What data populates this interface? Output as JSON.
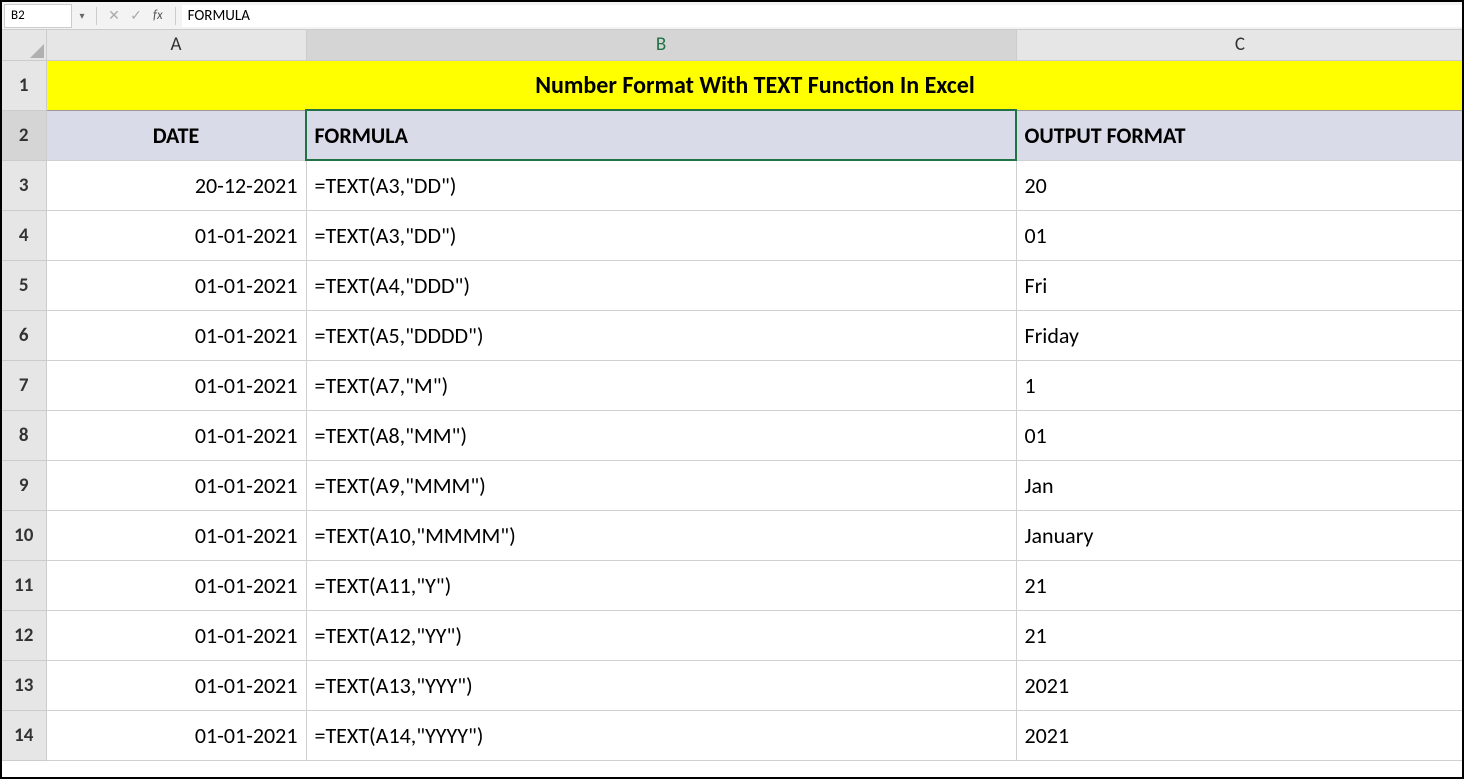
{
  "formula_bar": {
    "name_box": "B2",
    "fx_label": "fx",
    "formula_value": "FORMULA"
  },
  "columns": [
    "A",
    "B",
    "C"
  ],
  "row_headers": [
    "1",
    "2",
    "3",
    "4",
    "5",
    "6",
    "7",
    "8",
    "9",
    "10",
    "11",
    "12",
    "13",
    "14"
  ],
  "title": "Number Format With TEXT Function In Excel",
  "headers": {
    "A": "DATE",
    "B": "FORMULA",
    "C": "OUTPUT FORMAT"
  },
  "rows": [
    {
      "A": "20-12-2021",
      "B": "=TEXT(A3,\"DD\")",
      "C": "20"
    },
    {
      "A": "01-01-2021",
      "B": "=TEXT(A3,\"DD\")",
      "C": "01"
    },
    {
      "A": "01-01-2021",
      "B": "=TEXT(A4,\"DDD\")",
      "C": "Fri"
    },
    {
      "A": "01-01-2021",
      "B": "=TEXT(A5,\"DDDD\")",
      "C": "Friday"
    },
    {
      "A": "01-01-2021",
      "B": "=TEXT(A7,\"M\")",
      "C": "1"
    },
    {
      "A": "01-01-2021",
      "B": "=TEXT(A8,\"MM\")",
      "C": "01"
    },
    {
      "A": "01-01-2021",
      "B": "=TEXT(A9,\"MMM\")",
      "C": "Jan"
    },
    {
      "A": "01-01-2021",
      "B": "=TEXT(A10,\"MMMM\")",
      "C": "January"
    },
    {
      "A": "01-01-2021",
      "B": "=TEXT(A11,\"Y\")",
      "C": "21"
    },
    {
      "A": "01-01-2021",
      "B": "=TEXT(A12,\"YY\")",
      "C": "21"
    },
    {
      "A": "01-01-2021",
      "B": "=TEXT(A13,\"YYY\")",
      "C": "2021"
    },
    {
      "A": "01-01-2021",
      "B": "=TEXT(A14,\"YYYY\")",
      "C": "2021"
    }
  ],
  "selected_cell": "B2"
}
